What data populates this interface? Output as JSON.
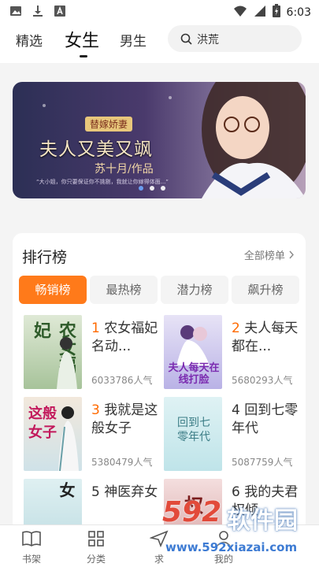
{
  "status_bar": {
    "time": "6:03",
    "left_icons": [
      "image-icon",
      "download-icon",
      "font-icon"
    ],
    "right_icons": [
      "wifi-icon",
      "signal-icon",
      "battery-icon"
    ]
  },
  "top_nav": {
    "tabs": [
      {
        "label": "精选",
        "active": false
      },
      {
        "label": "女生",
        "active": true
      },
      {
        "label": "男生",
        "active": false
      }
    ],
    "search_text": "洪荒"
  },
  "banner": {
    "badge": "替嫁娇妻",
    "title": "夫人又美又飒",
    "author": "苏十月/作品",
    "quote": "“大小姐，你只要保证你不挑剔，我就让你嫁得体面...”",
    "dots": [
      true,
      false,
      false
    ]
  },
  "ranking": {
    "title": "排行榜",
    "all_label": "全部榜单",
    "tabs": [
      {
        "label": "畅销榜",
        "active": true
      },
      {
        "label": "最热榜",
        "active": false
      },
      {
        "label": "潜力榜",
        "active": false
      },
      {
        "label": "飙升榜",
        "active": false
      }
    ],
    "books": [
      {
        "rank": "1",
        "name": "农女福妃名动...",
        "popularity": "6033786人气",
        "cover_text": "农女福妃",
        "cover_colors": [
          "#dfe9d6",
          "#a7c39a"
        ]
      },
      {
        "rank": "2",
        "name": "夫人每天都在...",
        "popularity": "5680293人气",
        "cover_text": "夫人每天在线打脸",
        "cover_colors": [
          "#e7e3f6",
          "#b9b2e6"
        ]
      },
      {
        "rank": "3",
        "name": "我就是这般女子",
        "popularity": "5380479人气",
        "cover_text": "这般女子",
        "cover_colors": [
          "#f2e8dc",
          "#cfe2e8"
        ]
      },
      {
        "rank": "4",
        "name": "回到七零年代",
        "popularity": "5087759人气",
        "cover_text": "回到七零年代",
        "cover_colors": [
          "#dff2f4",
          "#bfe4e9"
        ]
      },
      {
        "rank": "5",
        "name": "神医弃女",
        "popularity": "",
        "cover_text": "神医弃女",
        "cover_colors": [
          "#dff0f2",
          "#c7e2e6"
        ]
      },
      {
        "rank": "6",
        "name": "我的夫君权倾...",
        "popularity": "",
        "cover_text": "权",
        "cover_colors": [
          "#f4dede",
          "#e0b7b7"
        ]
      }
    ]
  },
  "bottom_nav": [
    {
      "label": "书架",
      "icon": "book-icon"
    },
    {
      "label": "分类",
      "icon": "grid-icon"
    },
    {
      "label": "求",
      "icon": "send-icon"
    },
    {
      "label": "我的",
      "icon": "profile-icon"
    }
  ],
  "watermark": {
    "logo_number": "592",
    "logo_text": "软件园",
    "url": "www.592xiazai.com"
  }
}
